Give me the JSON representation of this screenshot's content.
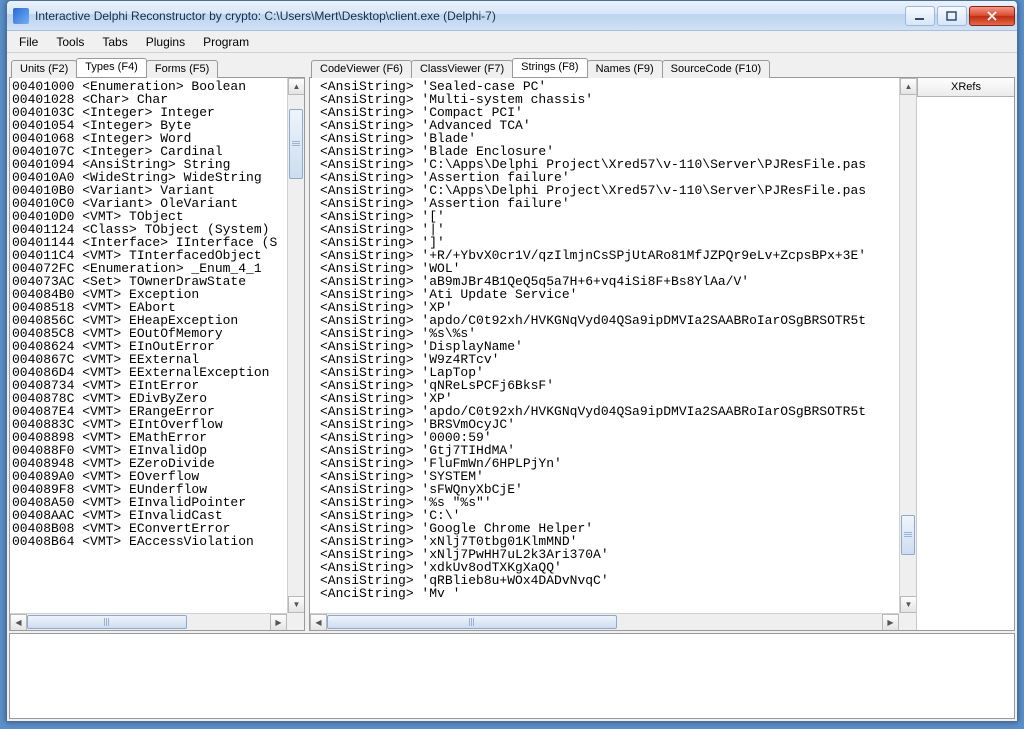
{
  "window": {
    "title": "Interactive Delphi Reconstructor by crypto: C:\\Users\\Mert\\Desktop\\client.exe (Delphi-7)"
  },
  "menubar": [
    "File",
    "Tools",
    "Tabs",
    "Plugins",
    "Program"
  ],
  "left_tabs": {
    "items": [
      "Units (F2)",
      "Types (F4)",
      "Forms (F5)"
    ],
    "active_index": 1
  },
  "right_tabs": {
    "items": [
      "CodeViewer (F6)",
      "ClassViewer (F7)",
      "Strings (F8)",
      "Names (F9)",
      "SourceCode (F10)"
    ],
    "active_index": 2
  },
  "xrefs_header": "XRefs",
  "types_list": [
    "00401000 <Enumeration> Boolean",
    "00401028 <Char> Char",
    "0040103C <Integer> Integer",
    "00401054 <Integer> Byte",
    "00401068 <Integer> Word",
    "0040107C <Integer> Cardinal",
    "00401094 <AnsiString> String",
    "004010A0 <WideString> WideString",
    "004010B0 <Variant> Variant",
    "004010C0 <Variant> OleVariant",
    "004010D0 <VMT> TObject",
    "00401124 <Class> TObject (System)",
    "00401144 <Interface> IInterface (S",
    "004011C4 <VMT> TInterfacedObject",
    "004072FC <Enumeration> _Enum_4_1",
    "004073AC <Set> TOwnerDrawState",
    "004084B0 <VMT> Exception",
    "00408518 <VMT> EAbort",
    "0040856C <VMT> EHeapException",
    "004085C8 <VMT> EOutOfMemory",
    "00408624 <VMT> EInOutError",
    "0040867C <VMT> EExternal",
    "004086D4 <VMT> EExternalException",
    "00408734 <VMT> EIntError",
    "0040878C <VMT> EDivByZero",
    "004087E4 <VMT> ERangeError",
    "0040883C <VMT> EIntOverflow",
    "00408898 <VMT> EMathError",
    "004088F0 <VMT> EInvalidOp",
    "00408948 <VMT> EZeroDivide",
    "004089A0 <VMT> EOverflow",
    "004089F8 <VMT> EUnderflow",
    "00408A50 <VMT> EInvalidPointer",
    "00408AAC <VMT> EInvalidCast",
    "00408B08 <VMT> EConvertError",
    "00408B64 <VMT> EAccessViolation"
  ],
  "strings_list": [
    "<AnsiString> 'Sealed-case PC'",
    "<AnsiString> 'Multi-system chassis'",
    "<AnsiString> 'Compact PCI'",
    "<AnsiString> 'Advanced TCA'",
    "<AnsiString> 'Blade'",
    "<AnsiString> 'Blade Enclosure'",
    "<AnsiString> 'C:\\Apps\\Delphi Project\\Xred57\\v-110\\Server\\PJResFile.pas",
    "<AnsiString> 'Assertion failure'",
    "<AnsiString> 'C:\\Apps\\Delphi Project\\Xred57\\v-110\\Server\\PJResFile.pas",
    "<AnsiString> 'Assertion failure'",
    "<AnsiString> '['",
    "<AnsiString> '|'",
    "<AnsiString> ']'",
    "<AnsiString> '+R/+YbvX0cr1V/qzIlmjnCsSPjUtARo81MfJZPQr9eLv+ZcpsBPx+3E'",
    "<AnsiString> 'WOL'",
    "<AnsiString> 'aB9mJBr4B1QeQ5q5a7H+6+vq4iSi8F+Bs8YlAa/V'",
    "<AnsiString> 'Ati Update Service'",
    "<AnsiString> 'XP'",
    "<AnsiString> 'apdo/C0t92xh/HVKGNqVyd04QSa9ipDMVIa2SAABRoIarOSgBRSOTR5t",
    "<AnsiString> '%s\\%s'",
    "<AnsiString> 'DisplayName'",
    "<AnsiString> 'W9z4RTcv'",
    "<AnsiString> 'LapTop'",
    "<AnsiString> 'qNReLsPCFj6BksF'",
    "<AnsiString> 'XP'",
    "<AnsiString> 'apdo/C0t92xh/HVKGNqVyd04QSa9ipDMVIa2SAABRoIarOSgBRSOTR5t",
    "<AnsiString> 'BRSVmOcyJC'",
    "<AnsiString> '0000:59'",
    "<AnsiString> 'Gtj7TIHdMA'",
    "<AnsiString> 'FluFmWn/6HPLPjYn'",
    "<AnsiString> 'SYSTEM'",
    "<AnsiString> 'sFWQnyXbCjE'",
    "<AnsiString> '%s \"%s\"'",
    "<AnsiString> 'C:\\'",
    "<AnsiString> 'Google Chrome Helper'",
    "<AnsiString> 'xNlj7T0tbg01KlmMND'",
    "<AnsiString> 'xNlj7PwHH7uL2k3Ari370A'",
    "<AnsiString> 'xdkUv8odTXKgXaQQ'",
    "<AnsiString> 'qRBlieb8u+WOx4DADvNvqC'",
    "<AnciString> 'Mv '"
  ]
}
